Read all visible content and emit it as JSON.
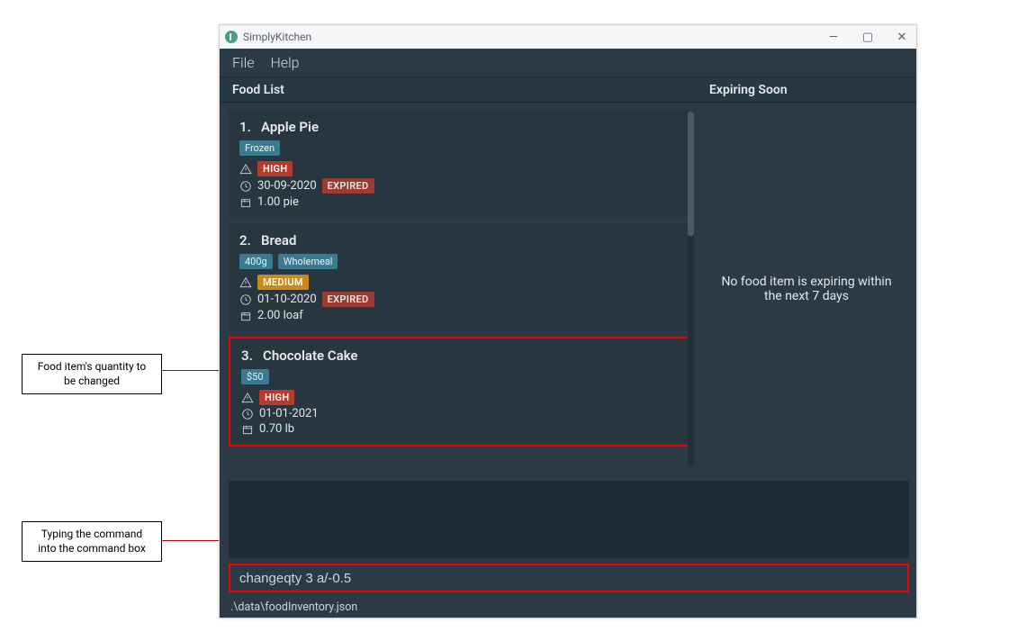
{
  "callouts": {
    "item": "Food item's quantity to be changed",
    "cmd": "Typing the command into the command box"
  },
  "window": {
    "title": "SimplyKitchen"
  },
  "menu": {
    "file": "File",
    "help": "Help"
  },
  "headers": {
    "foodList": "Food List",
    "expiring": "Expiring Soon"
  },
  "rightPane": {
    "empty": "No food item is expiring within the next 7 days"
  },
  "foods": [
    {
      "num": "1.",
      "name": "Apple Pie",
      "tags": [
        "Frozen"
      ],
      "priority": "HIGH",
      "date": "30-09-2020",
      "expired": "EXPIRED",
      "qty": "1.00 pie",
      "highlight": false
    },
    {
      "num": "2.",
      "name": "Bread",
      "tags": [
        "400g",
        "Wholemeal"
      ],
      "priority": "MEDIUM",
      "date": "01-10-2020",
      "expired": "EXPIRED",
      "qty": "2.00 loaf",
      "highlight": false
    },
    {
      "num": "3.",
      "name": "Chocolate Cake",
      "tags": [
        "$50"
      ],
      "priority": "HIGH",
      "date": "01-01-2021",
      "expired": "",
      "qty": "0.70 lb",
      "highlight": true
    }
  ],
  "command": {
    "value": "changeqty 3 a/-0.5"
  },
  "status": {
    "path": ".\\data\\foodInventory.json"
  }
}
